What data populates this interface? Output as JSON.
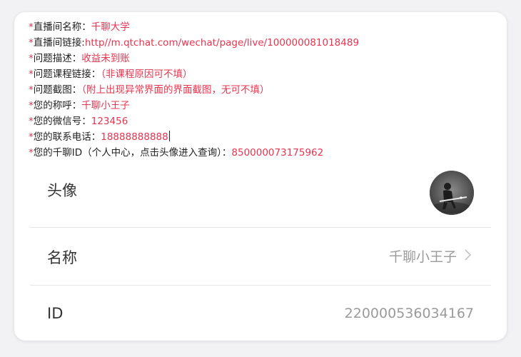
{
  "form": {
    "star": "*",
    "lines": [
      {
        "label": "直播间名称：",
        "value": "千聊大学"
      },
      {
        "label": "直播间链接:",
        "value": "http//m.qtchat.com/wechat/page/live/100000081018489"
      },
      {
        "label": "问题描述：",
        "value": "收益未到账"
      },
      {
        "label": "问题课程链接：",
        "value": "（非课程原因可不填）"
      },
      {
        "label": "问题截图：",
        "value": "（附上出现异常界面的界面截图，无可不填）"
      },
      {
        "label": "您的称呼：",
        "value": "千聊小王子"
      },
      {
        "label": "您的微信号：",
        "value": "123456"
      },
      {
        "label": "您的联系电话：",
        "value": "18888888888"
      },
      {
        "label": "您的千聊ID（个人中心，点击头像进入查询）：",
        "value": "850000073175962"
      }
    ]
  },
  "profile": {
    "avatar_label": "头像",
    "name_label": "名称",
    "name_value": "千聊小王子",
    "id_label": "ID",
    "id_value": "220000536034167"
  },
  "colors": {
    "accent": "#e8344e",
    "muted": "#9a9a9a",
    "text": "#333333"
  }
}
